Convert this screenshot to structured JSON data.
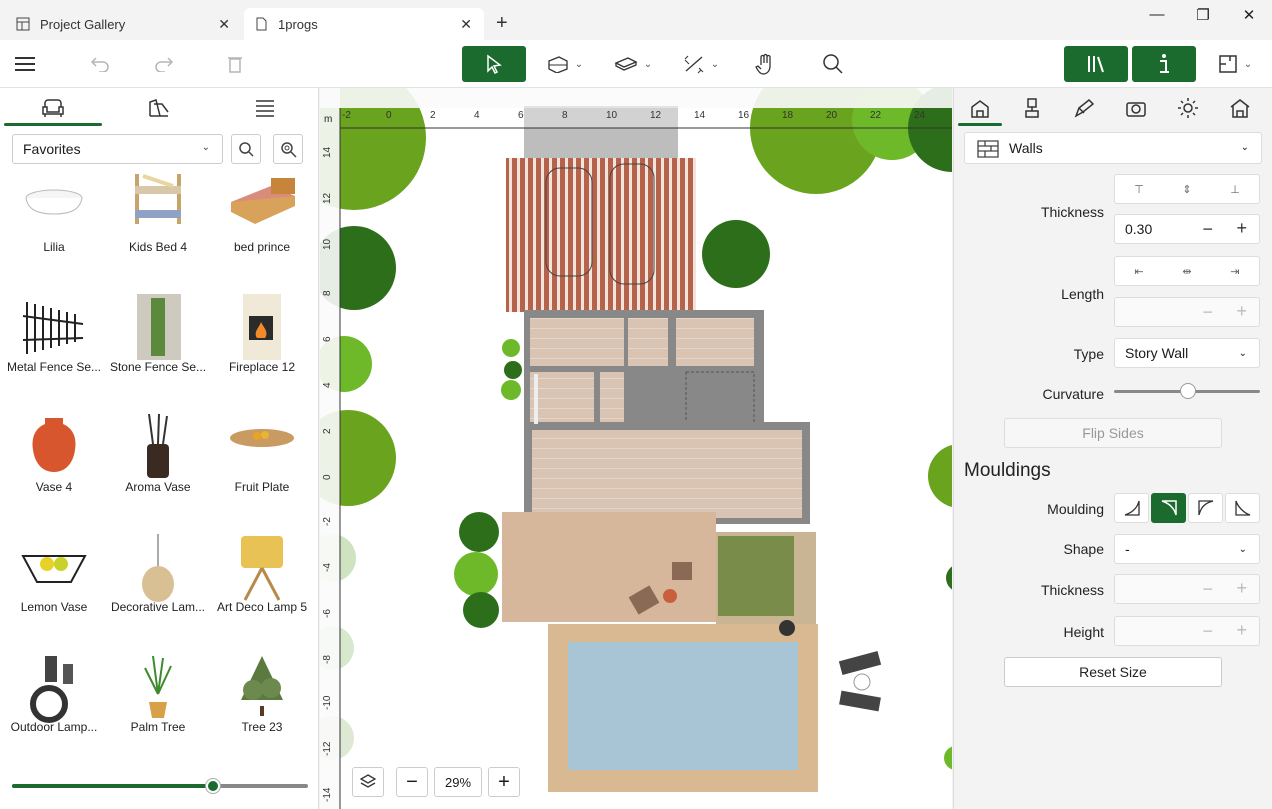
{
  "tabs": [
    {
      "label": "Project Gallery",
      "icon": "gallery-icon"
    },
    {
      "label": "1progs",
      "icon": "document-icon"
    }
  ],
  "left": {
    "favorites_label": "Favorites",
    "items": [
      {
        "label": "Lilia"
      },
      {
        "label": "Kids Bed 4"
      },
      {
        "label": "bed prince"
      },
      {
        "label": "Metal Fence Se..."
      },
      {
        "label": "Stone Fence Se..."
      },
      {
        "label": "Fireplace 12"
      },
      {
        "label": "Vase 4"
      },
      {
        "label": "Aroma Vase"
      },
      {
        "label": "Fruit Plate"
      },
      {
        "label": "Lemon Vase"
      },
      {
        "label": "Decorative Lam..."
      },
      {
        "label": "Art Deco Lamp 5"
      },
      {
        "label": "Outdoor Lamp..."
      },
      {
        "label": "Palm Tree"
      },
      {
        "label": "Tree 23"
      }
    ],
    "size_slider": 0.68
  },
  "canvas": {
    "ruler_unit": "m",
    "h_ticks": [
      "-2",
      "0",
      "2",
      "4",
      "6",
      "8",
      "10",
      "12",
      "14",
      "16",
      "18",
      "20",
      "22",
      "24"
    ],
    "v_ticks": [
      "14",
      "12",
      "10",
      "8",
      "6",
      "4",
      "2",
      "0",
      "-2",
      "-4",
      "-6",
      "-8",
      "-10",
      "-12",
      "-14"
    ],
    "zoom": "29%"
  },
  "right": {
    "category": "Walls",
    "thickness_label": "Thickness",
    "thickness_value": "0.30",
    "length_label": "Length",
    "type_label": "Type",
    "type_value": "Story Wall",
    "curvature_label": "Curvature",
    "flip_label": "Flip Sides",
    "mouldings_heading": "Mouldings",
    "moulding_label": "Moulding",
    "shape_label": "Shape",
    "shape_value": "-",
    "m_thickness_label": "Thickness",
    "height_label": "Height",
    "reset_label": "Reset Size"
  },
  "colors": {
    "accent": "#1b6b2e"
  }
}
